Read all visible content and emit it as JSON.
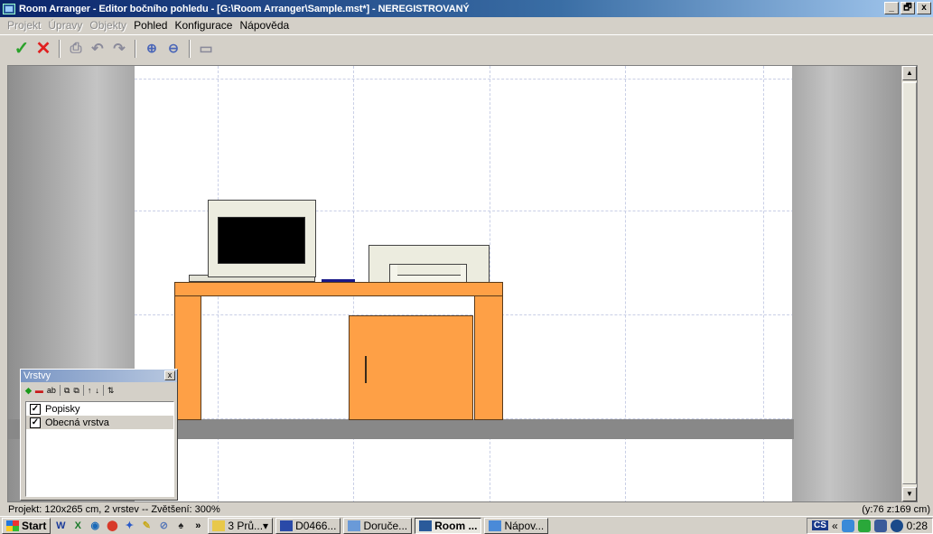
{
  "window": {
    "title": "Room Arranger - Editor bočního pohledu - [G:\\Room Arranger\\Sample.mst*] - NEREGISTROVANÝ",
    "minimize": "_",
    "maximize": "🗗",
    "close": "x"
  },
  "menu": {
    "items": [
      {
        "label": "Projekt",
        "enabled": false
      },
      {
        "label": "Úpravy",
        "enabled": false
      },
      {
        "label": "Objekty",
        "enabled": false
      },
      {
        "label": "Pohled",
        "enabled": true
      },
      {
        "label": "Konfigurace",
        "enabled": true
      },
      {
        "label": "Nápověda",
        "enabled": true
      }
    ]
  },
  "toolbar": {
    "ok": "✓",
    "cancel": "✕",
    "print": "⎙",
    "undo": "↶",
    "redo": "↷",
    "zoom_in": "⊕",
    "zoom_out": "⊖",
    "ruler": "▭"
  },
  "layers": {
    "title": "Vrstvy",
    "close": "x",
    "tools": [
      "◆",
      "▬",
      "ab",
      "⧉",
      "⧉",
      "↑",
      "↓",
      "⇅"
    ],
    "items": [
      {
        "label": "Popisky",
        "checked": true,
        "selected": false
      },
      {
        "label": "Obecná vrstva",
        "checked": true,
        "selected": true
      }
    ],
    "check_mark": "✓"
  },
  "status": {
    "left": "Projekt: 120x265 cm, 2 vrstev -- Zvětšení: 300%",
    "right": "(y:76 z:169 cm)"
  },
  "taskbar": {
    "start": "Start",
    "quicklaunch": [
      "W",
      "X",
      "◉",
      "⬤",
      "✦",
      "✎",
      "⊘",
      "♠"
    ],
    "more": "»",
    "tasks": [
      {
        "label": "3 Prů...",
        "dropdown": "▾",
        "active": false
      },
      {
        "label": "D0466...",
        "active": false
      },
      {
        "label": "Doruče...",
        "active": false
      },
      {
        "label": "Room ...",
        "active": true
      },
      {
        "label": "Nápov...",
        "active": false
      }
    ],
    "lang": "CS",
    "tray_more": "«",
    "clock": "0:28"
  },
  "colors": {
    "furniture": "#fea046",
    "floor": "#888888",
    "titlebar": "#0a246a"
  }
}
